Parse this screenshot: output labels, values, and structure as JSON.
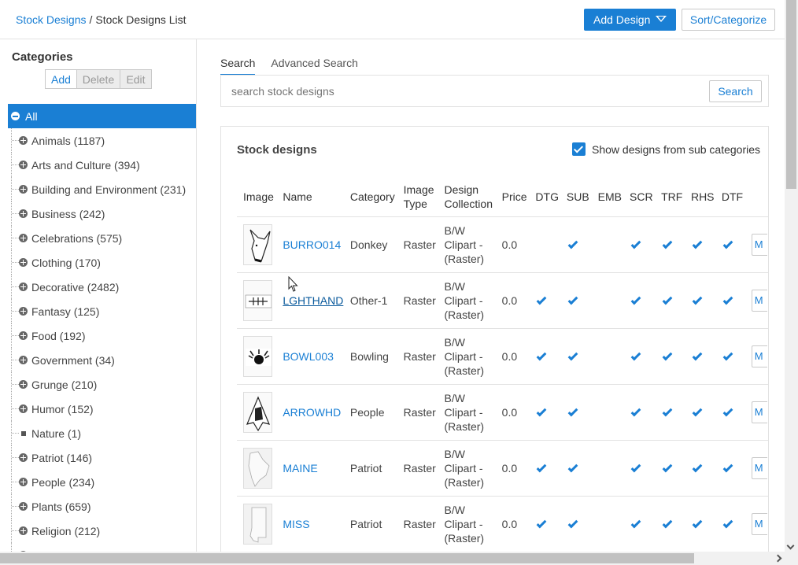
{
  "breadcrumb": {
    "root": "Stock Designs",
    "separator": "/",
    "current": "Stock Designs List"
  },
  "header": {
    "add_design": "Add Design",
    "sort_categorize": "Sort/Categorize"
  },
  "sidebar": {
    "title": "Categories",
    "buttons": {
      "add": "Add",
      "delete": "Delete",
      "edit": "Edit"
    },
    "all_label": "All",
    "items": [
      {
        "label": "Animals (1187)",
        "expandable": true
      },
      {
        "label": "Arts and Culture (394)",
        "expandable": true
      },
      {
        "label": "Building and Environment (231)",
        "expandable": true
      },
      {
        "label": "Business (242)",
        "expandable": true
      },
      {
        "label": "Celebrations (575)",
        "expandable": true
      },
      {
        "label": "Clothing (170)",
        "expandable": true
      },
      {
        "label": "Decorative (2482)",
        "expandable": true
      },
      {
        "label": "Fantasy (125)",
        "expandable": true
      },
      {
        "label": "Food (192)",
        "expandable": true
      },
      {
        "label": "Government (34)",
        "expandable": true
      },
      {
        "label": "Grunge (210)",
        "expandable": true
      },
      {
        "label": "Humor (152)",
        "expandable": true
      },
      {
        "label": "Nature (1)",
        "expandable": false
      },
      {
        "label": "Patriot (146)",
        "expandable": true
      },
      {
        "label": "People (234)",
        "expandable": true
      },
      {
        "label": "Plants (659)",
        "expandable": true
      },
      {
        "label": "Religion (212)",
        "expandable": true
      },
      {
        "label": "Schools (...)",
        "expandable": true
      }
    ]
  },
  "tabs": {
    "search": "Search",
    "advanced": "Advanced Search"
  },
  "search": {
    "placeholder": "search stock designs",
    "button": "Search"
  },
  "panel": {
    "title": "Stock designs",
    "subcategories_label": "Show designs from sub categories",
    "subcategories_checked": true
  },
  "table": {
    "headers": {
      "image": "Image",
      "name": "Name",
      "category": "Category",
      "image_type_1": "Image",
      "image_type_2": "Type",
      "collection_1": "Design",
      "collection_2": "Collection",
      "price": "Price",
      "dtg": "DTG",
      "sub": "SUB",
      "emb": "EMB",
      "scr": "SCR",
      "trf": "TRF",
      "rhs": "RHS",
      "dtf": "DTF"
    },
    "rows": [
      {
        "name": "BURRO014",
        "category": "Donkey",
        "type": "Raster",
        "coll_1": "B/W",
        "coll_2": "Clipart -",
        "coll_3": "(Raster)",
        "price": "0.0",
        "dtg": false,
        "sub": true,
        "emb": false,
        "scr": true,
        "trf": true,
        "rhs": true,
        "dtf": true,
        "action": "M",
        "thumb": "donkey"
      },
      {
        "name": "LGHTHAND",
        "category": "Other-1",
        "type": "Raster",
        "coll_1": "B/W",
        "coll_2": "Clipart -",
        "coll_3": "(Raster)",
        "price": "0.0",
        "dtg": true,
        "sub": true,
        "emb": false,
        "scr": true,
        "trf": true,
        "rhs": true,
        "dtf": true,
        "action": "M",
        "thumb": "hand"
      },
      {
        "name": "BOWL003",
        "category": "Bowling",
        "type": "Raster",
        "coll_1": "B/W",
        "coll_2": "Clipart -",
        "coll_3": "(Raster)",
        "price": "0.0",
        "dtg": true,
        "sub": true,
        "emb": false,
        "scr": true,
        "trf": true,
        "rhs": true,
        "dtf": true,
        "action": "M",
        "thumb": "bowling"
      },
      {
        "name": "ARROWHD",
        "category": "People",
        "type": "Raster",
        "coll_1": "B/W",
        "coll_2": "Clipart -",
        "coll_3": "(Raster)",
        "price": "0.0",
        "dtg": true,
        "sub": true,
        "emb": false,
        "scr": true,
        "trf": true,
        "rhs": true,
        "dtf": true,
        "action": "M",
        "thumb": "arrowhead"
      },
      {
        "name": "MAINE",
        "category": "Patriot",
        "type": "Raster",
        "coll_1": "B/W",
        "coll_2": "Clipart -",
        "coll_3": "(Raster)",
        "price": "0.0",
        "dtg": true,
        "sub": true,
        "emb": false,
        "scr": true,
        "trf": true,
        "rhs": true,
        "dtf": true,
        "action": "M",
        "thumb": "maine"
      },
      {
        "name": "MISS",
        "category": "Patriot",
        "type": "Raster",
        "coll_1": "B/W",
        "coll_2": "Clipart -",
        "coll_3": "(Raster)",
        "price": "0.0",
        "dtg": true,
        "sub": true,
        "emb": false,
        "scr": true,
        "trf": true,
        "rhs": true,
        "dtf": true,
        "action": "M",
        "thumb": "miss"
      }
    ]
  },
  "colors": {
    "accent": "#1a7fd4",
    "border": "#e2e2e2"
  }
}
